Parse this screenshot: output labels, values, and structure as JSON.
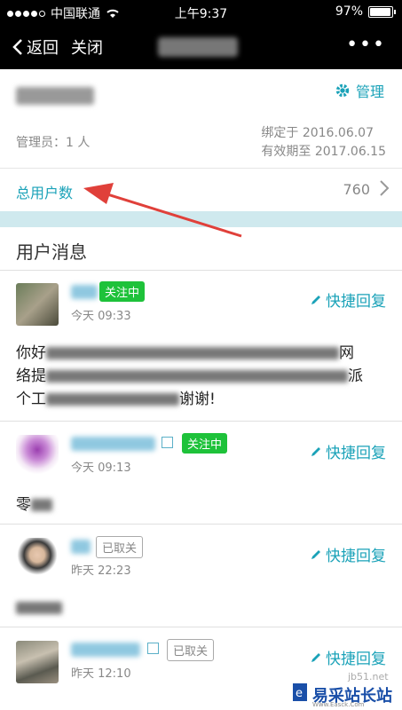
{
  "status_bar": {
    "carrier": "中国联通",
    "time": "上午9:37",
    "battery": "97%",
    "battery_level": 0.97
  },
  "nav": {
    "back_label": "返回",
    "close_label": "关闭",
    "more": "•••"
  },
  "account": {
    "manage_label": "管理",
    "admin_label": "管理员：1 人",
    "bind_date": "绑定于 2016.06.07",
    "expire_date": "有效期至 2017.06.15"
  },
  "total_users": {
    "label": "总用户数",
    "value": "760"
  },
  "section": {
    "title": "用户消息"
  },
  "messages": [
    {
      "badge": "关注中",
      "time": "今天 09:33",
      "reply": "快捷回复",
      "content_a": "你好",
      "content_b": "网",
      "content_c": "络提",
      "content_d": "派",
      "content_e": "个工",
      "content_f": "谢谢!"
    },
    {
      "badge": "关注中",
      "time": "今天 09:13",
      "reply": "快捷回复",
      "content_a": "零"
    },
    {
      "badge": "已取关",
      "time": "昨天 22:23",
      "reply": "快捷回复"
    },
    {
      "badge": "已取关",
      "time": "昨天 12:10",
      "reply": "快捷回复"
    }
  ],
  "watermark": {
    "text": "易采站长站",
    "url": "jb51.net",
    "sub": "Www.Easck.Com"
  },
  "colors": {
    "accent": "#1aa2b8",
    "follow_badge": "#1ec23a",
    "header_bg": "#000000",
    "band": "#cfe9ee",
    "arrow": "#e0403a"
  }
}
